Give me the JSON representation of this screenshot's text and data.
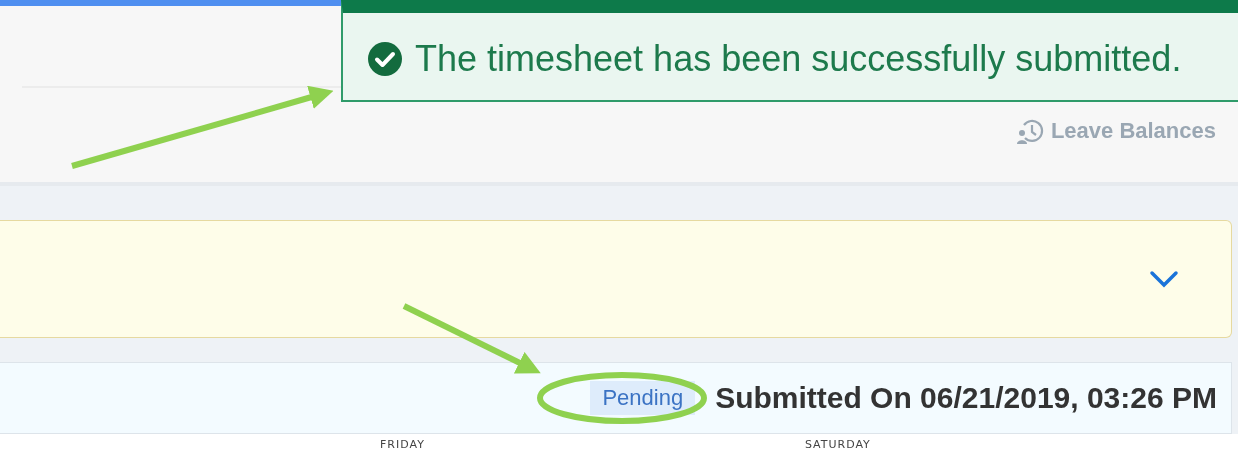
{
  "toast": {
    "message": "The timesheet has been successfully submitted.",
    "kind": "success"
  },
  "header": {
    "link": "Leave Balances"
  },
  "notice_panel": {
    "expanded": false
  },
  "timesheet": {
    "status": "Pending",
    "submitted": "Submitted On 06/21/2019, 03:26 PM"
  },
  "columns": [
    "FRIDAY",
    "SATURDAY"
  ]
}
